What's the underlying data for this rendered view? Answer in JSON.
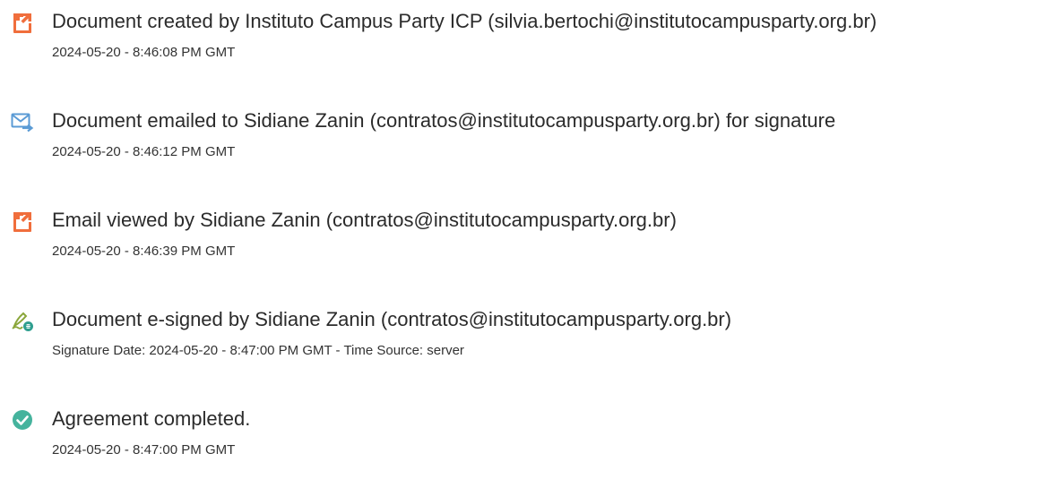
{
  "colors": {
    "document_icon": "#f06e3c",
    "email_icon": "#5b9bd5",
    "esign_icon": "#8aa63a",
    "esign_badge": "#2e9e8f",
    "check_icon": "#45b39d",
    "title_text": "#2b2b2b",
    "detail_text": "#333333"
  },
  "events": [
    {
      "icon": "document-created-icon",
      "title": "Document created by Instituto Campus Party ICP (silvia.bertochi@institutocampusparty.org.br)",
      "detail": "2024-05-20 - 8:46:08 PM GMT"
    },
    {
      "icon": "email-sent-icon",
      "title": "Document emailed to Sidiane Zanin (contratos@institutocampusparty.org.br) for signature",
      "detail": "2024-05-20 - 8:46:12 PM GMT"
    },
    {
      "icon": "document-viewed-icon",
      "title": "Email viewed by Sidiane Zanin (contratos@institutocampusparty.org.br)",
      "detail": "2024-05-20 - 8:46:39 PM GMT"
    },
    {
      "icon": "esign-pen-icon",
      "title": "Document e-signed by Sidiane Zanin (contratos@institutocampusparty.org.br)",
      "detail": "Signature Date: 2024-05-20 - 8:47:00 PM GMT - Time Source: server"
    },
    {
      "icon": "check-circle-icon",
      "title": "Agreement completed.",
      "detail": "2024-05-20 - 8:47:00 PM GMT"
    }
  ]
}
